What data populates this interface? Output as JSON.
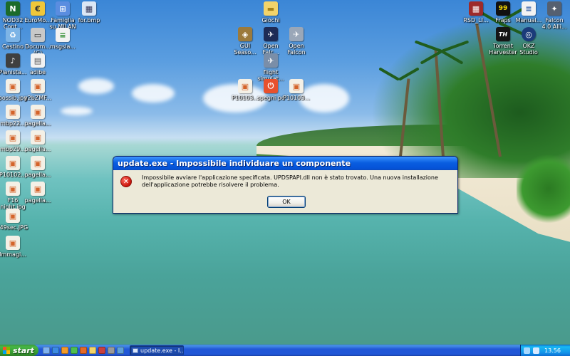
{
  "desktop": {
    "icons_left": [
      {
        "label": "NOD32\nCont...",
        "icon": "nod32-icon",
        "color": "#1c6b2a",
        "glyph": "N"
      },
      {
        "label": "EuroMo...",
        "icon": "euromobile-icon",
        "color": "#f0c73a",
        "glyph": "€"
      },
      {
        "label": "Famiglia\nsu MILAN",
        "icon": "folder-network-icon",
        "color": "#5a8de0",
        "glyph": "⊞"
      },
      {
        "label": "for.bmp",
        "icon": "bitmap-file-icon",
        "color": "#dce7f5",
        "glyph": "▦"
      },
      {
        "label": "Cestino",
        "icon": "recycle-bin-icon",
        "color": "#7db4e6",
        "glyph": "♻"
      },
      {
        "label": "Docum...\n(G)",
        "icon": "drive-icon",
        "color": "#c8c8c8",
        "glyph": "▭"
      },
      {
        "label": "msgsla...",
        "icon": "document-icon",
        "color": "#f2f2f2",
        "glyph": "≡"
      },
      {
        "label": "Pianista...",
        "icon": "pianista-icon",
        "color": "#3f3f3f",
        "glyph": "♪"
      },
      {
        "label": "adibe",
        "icon": "adibe-icon",
        "color": "#f2f2f2",
        "glyph": "▤"
      },
      {
        "label": "possib.jpg",
        "icon": "image-file-icon",
        "color": "#f4f0e6",
        "glyph": "▣"
      },
      {
        "label": "y2bZMF...",
        "icon": "image-file-icon",
        "color": "#f4f0e6",
        "glyph": "▣"
      },
      {
        "label": "mbp22...",
        "icon": "image-file-icon",
        "color": "#f4f0e6",
        "glyph": "▣"
      },
      {
        "label": "pagella...",
        "icon": "image-file-icon",
        "color": "#f4f0e6",
        "glyph": "▣"
      },
      {
        "label": "mbp29...",
        "icon": "image-file-icon",
        "color": "#f4f0e6",
        "glyph": "▣"
      },
      {
        "label": "pagella...",
        "icon": "image-file-icon",
        "color": "#f4f0e6",
        "glyph": "▣"
      },
      {
        "label": "P10102...",
        "icon": "image-file-icon",
        "color": "#f4f0e6",
        "glyph": "▣"
      },
      {
        "label": "pagella...",
        "icon": "image-file-icon",
        "color": "#f4f0e6",
        "glyph": "▣"
      },
      {
        "label": "F16\nnight.jpg",
        "icon": "image-file-icon",
        "color": "#f4f0e6",
        "glyph": "▣"
      },
      {
        "label": "pagella...",
        "icon": "image-file-icon",
        "color": "#f4f0e6",
        "glyph": "▣"
      },
      {
        "label": "f49sec.JPG",
        "icon": "image-file-icon",
        "color": "#f4f0e6",
        "glyph": "▣"
      },
      {
        "label": "Immagi...",
        "icon": "image-file-icon",
        "color": "#f4f0e6",
        "glyph": "▣"
      }
    ],
    "icons_middle": [
      {
        "label": "Giochi",
        "icon": "folder-icon",
        "color": "#f3d46a",
        "glyph": "▬"
      },
      {
        "label": "GUI\nSeaso...",
        "icon": "gui-season-icon",
        "color": "#9b7a3c",
        "glyph": "◈"
      },
      {
        "label": "Open\nFalc...",
        "icon": "open-falcon-icon",
        "color": "#1d2b55",
        "glyph": "✈"
      },
      {
        "label": "Open\nFalcon",
        "icon": "airplane-icon",
        "color": "#9aa7b8",
        "glyph": "✈"
      },
      {
        "label": "flight\nsimulat...",
        "icon": "flight-simulator-icon",
        "color": "#7a8ea8",
        "glyph": "✈"
      },
      {
        "label": "P10103...",
        "icon": "image-file-icon",
        "color": "#f4f0e6",
        "glyph": "▣"
      },
      {
        "label": "spegni pc",
        "icon": "shutdown-icon",
        "color": "#e8512d",
        "glyph": "⏻"
      },
      {
        "label": "P10103...",
        "icon": "image-file-icon",
        "color": "#f4f0e6",
        "glyph": "▣"
      }
    ],
    "icons_right": [
      {
        "label": "RSD_LI...",
        "icon": "rsd-icon",
        "color": "#9d2a2a",
        "glyph": "▦"
      },
      {
        "label": "Fraps",
        "icon": "fraps-icon",
        "color": "#111111",
        "glyph": "99"
      },
      {
        "label": "Manual...",
        "icon": "manual-icon",
        "color": "#f2f2f2",
        "glyph": "≡"
      },
      {
        "label": "Falcon\n4.0 Alli...",
        "icon": "falcon-icon",
        "color": "#556070",
        "glyph": "✦"
      },
      {
        "label": "Torrent\nHarvester",
        "icon": "torrent-harvester-icon",
        "color": "#151515",
        "glyph": "TH"
      },
      {
        "label": "OKZ\nStudio",
        "icon": "okz-studio-icon",
        "color": "#1b3b7a",
        "glyph": "◎"
      }
    ]
  },
  "dialog": {
    "title": "update.exe - Impossibile individuare un componente",
    "message": "Impossibile avviare l'applicazione specificata. UPDSPAPI.dll non è stato trovato. Una nuova installazione dell'applicazione potrebbe risolvere il problema.",
    "ok_label": "OK",
    "icon": "error-icon"
  },
  "taskbar": {
    "start_label": "start",
    "quick_launch": [
      {
        "icon": "show-desktop-icon",
        "color": "#7fb2f0"
      },
      {
        "icon": "internet-explorer-icon",
        "color": "#3c8be3"
      },
      {
        "icon": "media-player-icon",
        "color": "#f39b2a"
      },
      {
        "icon": "messenger-icon",
        "color": "#4fbf4f"
      },
      {
        "icon": "firefox-icon",
        "color": "#e46a2a"
      },
      {
        "icon": "folder-icon",
        "color": "#f3d46a"
      },
      {
        "icon": "app-icon",
        "color": "#c84040"
      },
      {
        "icon": "app-icon",
        "color": "#9a9a9a"
      },
      {
        "icon": "app-icon",
        "color": "#5fa0d8"
      }
    ],
    "task_label": "update.exe - I...",
    "tray_icons": [
      {
        "icon": "network-icon",
        "color": "#a7d8ff"
      },
      {
        "icon": "antivirus-icon",
        "color": "#d6e8ff"
      }
    ],
    "clock": "13.56"
  },
  "colors": {
    "titlebar": "#0553d8",
    "dialog_bg": "#ece9d8",
    "taskbar": "#2157d7",
    "start": "#379b2f"
  }
}
